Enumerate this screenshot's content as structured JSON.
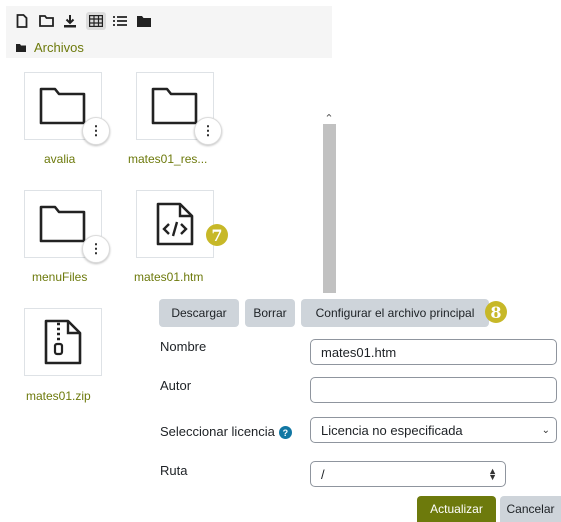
{
  "breadcrumb": {
    "label": "Archivos"
  },
  "files": [
    {
      "name": "avalia"
    },
    {
      "name": "mates01_res..."
    },
    {
      "name": "menuFiles"
    },
    {
      "name": "mates01.htm"
    },
    {
      "name": "mates01.zip"
    }
  ],
  "badges": {
    "seven": "7",
    "eight": "8"
  },
  "dialog": {
    "download_label": "Descargar",
    "delete_label": "Borrar",
    "set_main_label": "Configurar el archivo principal",
    "name_label": "Nombre",
    "name_value": "mates01.htm",
    "author_label": "Autor",
    "author_value": "",
    "license_label": "Seleccionar licencia",
    "license_value": "Licencia no especificada",
    "path_label": "Ruta",
    "path_value": "/",
    "update_label": "Actualizar",
    "cancel_label": "Cancelar"
  },
  "colors": {
    "accent": "#6d7a0c",
    "badge": "#c7b828",
    "help": "#1177a3"
  }
}
